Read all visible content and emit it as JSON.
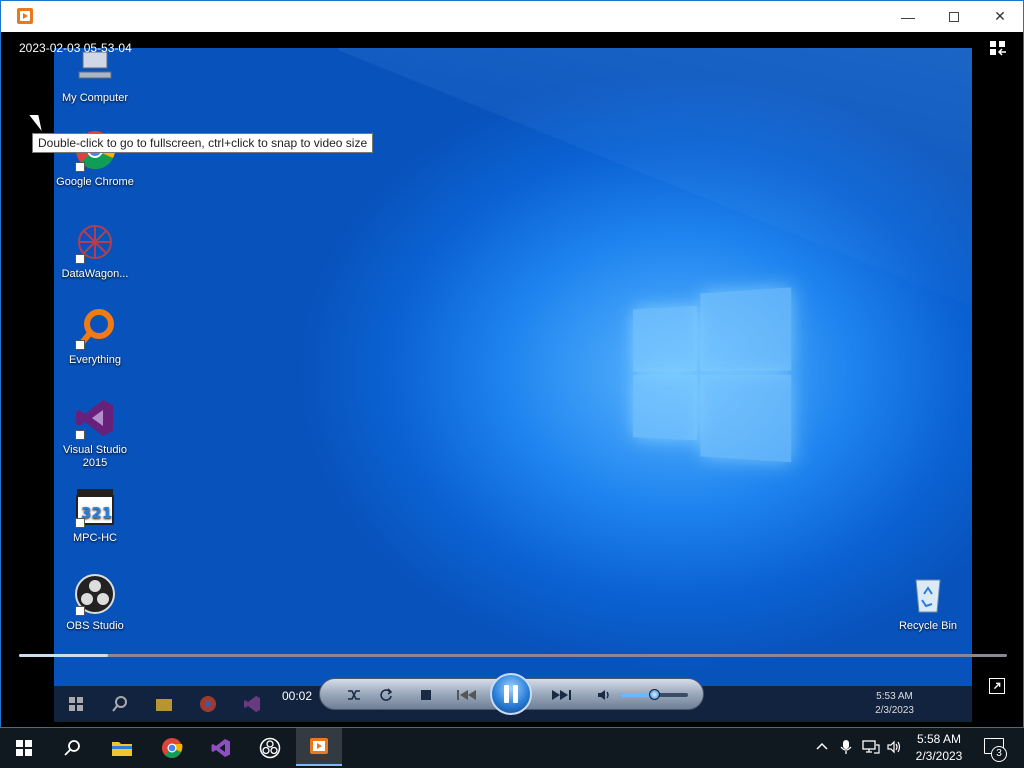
{
  "player": {
    "timestamp": "2023-02-03 05-53-04",
    "tooltip": "Double-click to go to fullscreen, ctrl+click to snap to video size",
    "elapsed": "00:02",
    "seek_fraction": 0.09,
    "volume_fraction": 0.5
  },
  "titlebar": {
    "minimize": "—",
    "close": "✕"
  },
  "desktop_icons": [
    {
      "label": "My Computer",
      "icon": "computer-icon"
    },
    {
      "label": "Google Chrome",
      "icon": "chrome-icon"
    },
    {
      "label": "DataWagon...",
      "icon": "datawagon-icon"
    },
    {
      "label": "Everything",
      "icon": "search-magnifier-icon"
    },
    {
      "label": "Visual Studio 2015",
      "icon": "visual-studio-icon"
    },
    {
      "label": "MPC-HC",
      "icon": "mpc-hc-icon"
    },
    {
      "label": "OBS Studio",
      "icon": "obs-icon"
    },
    {
      "label": "Recycle Bin",
      "icon": "recycle-bin-icon"
    }
  ],
  "remote_taskbar": {
    "time": "5:53 AM",
    "date": "2/3/2023"
  },
  "taskbar": {
    "time": "5:58 AM",
    "date": "2/3/2023",
    "notification_count": "3"
  },
  "colors": {
    "accent": "#1f84ef",
    "taskbar": "#101820"
  }
}
